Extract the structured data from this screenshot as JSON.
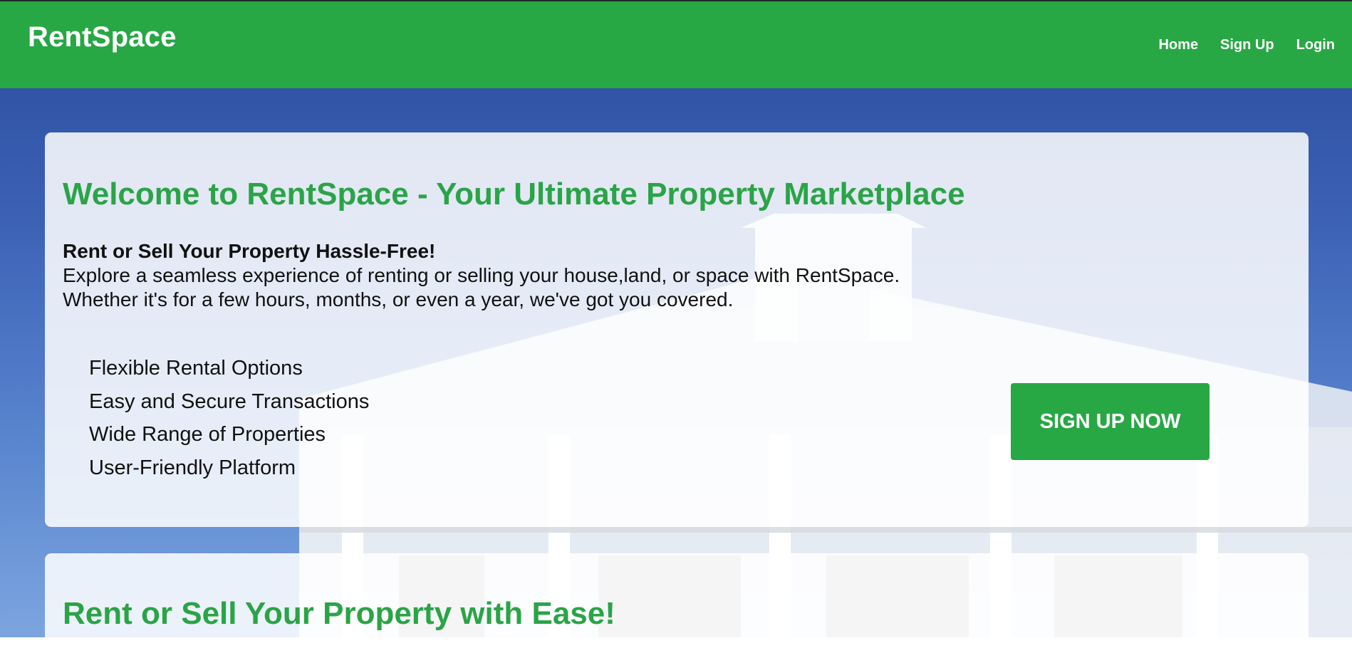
{
  "header": {
    "brand": "RentSpace",
    "nav": [
      {
        "label": "Home"
      },
      {
        "label": "Sign Up"
      },
      {
        "label": "Login"
      }
    ]
  },
  "hero": {
    "title": "Welcome to RentSpace - Your Ultimate Property Marketplace",
    "subtitle": "Rent or Sell Your Property Hassle-Free!",
    "description_line1": "Explore a seamless experience of renting or selling your house,land, or space with RentSpace.",
    "description_line2": "Whether it's for a few hours, months, or even a year, we've got you covered.",
    "features": [
      "Flexible Rental Options",
      "Easy and Secure Transactions",
      "Wide Range of Properties",
      "User-Friendly Platform"
    ],
    "cta_label": "SIGN UP NOW"
  },
  "section2": {
    "title": "Rent or Sell Your Property with Ease!"
  },
  "colors": {
    "brand_green": "#28a745",
    "heading_green": "#2aa447",
    "sky_blue": "#2a4b9b"
  },
  "background_image": "house-photo"
}
